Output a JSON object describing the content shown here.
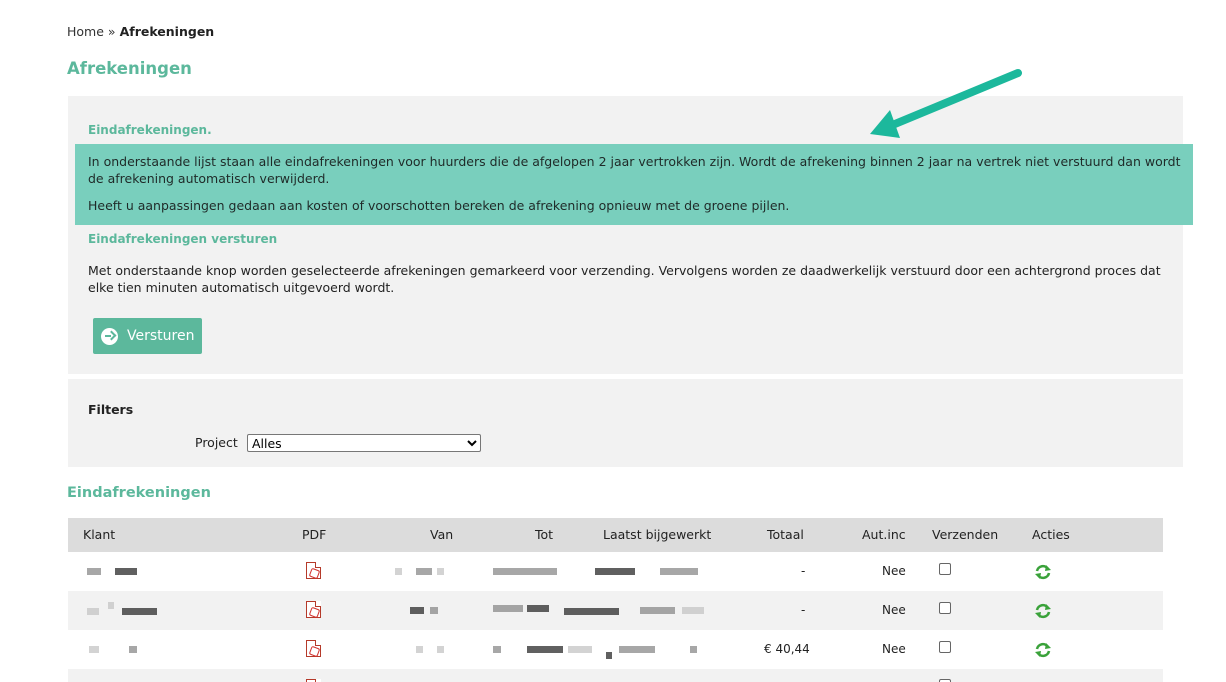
{
  "breadcrumb": {
    "home": "Home",
    "separator": "»",
    "current": "Afrekeningen"
  },
  "page_title": "Afrekeningen",
  "info_panel": {
    "heading1": "Eindafrekeningen.",
    "para1": "In onderstaande lijst staan alle eindafrekeningen voor huurders die de afgelopen 2 jaar vertrokken zijn. Wordt de afrekening binnen 2 jaar na vertrek niet verstuurd dan wordt de afrekening automatisch verwijderd.",
    "para2": "Heeft u aanpassingen gedaan aan kosten of voorschotten bereken de afrekening opnieuw met de groene pijlen.",
    "heading2": "Eindafrekeningen versturen",
    "description": "Met onderstaande knop worden geselecteerde afrekeningen gemarkeerd voor verzending. Vervolgens worden ze daadwerkelijk verstuurd door een achtergrond proces dat elke tien minuten automatisch uitgevoerd wordt.",
    "send_button": "Versturen"
  },
  "filters": {
    "title": "Filters",
    "project_label": "Project",
    "project_selected": "Alles"
  },
  "table_section_title": "Eindafrekeningen",
  "table": {
    "columns": [
      "Klant",
      "PDF",
      "Van",
      "Tot",
      "Laatst bijgewerkt",
      "Totaal",
      "Aut.inc",
      "Verzenden",
      "Acties"
    ],
    "rows": [
      {
        "totaal": "-",
        "aut_inc": "Nee"
      },
      {
        "totaal": "-",
        "aut_inc": "Nee"
      },
      {
        "totaal": "€ 40,44",
        "aut_inc": "Nee"
      }
    ]
  },
  "colors": {
    "accent": "#5cb89c",
    "highlight": "#79cfbd",
    "panel": "#f2f2f2",
    "arrow": "#1cb89c"
  },
  "icons": [
    "arrow-right-circle-icon",
    "pdf-icon",
    "refresh-icon",
    "annotation-arrow"
  ]
}
